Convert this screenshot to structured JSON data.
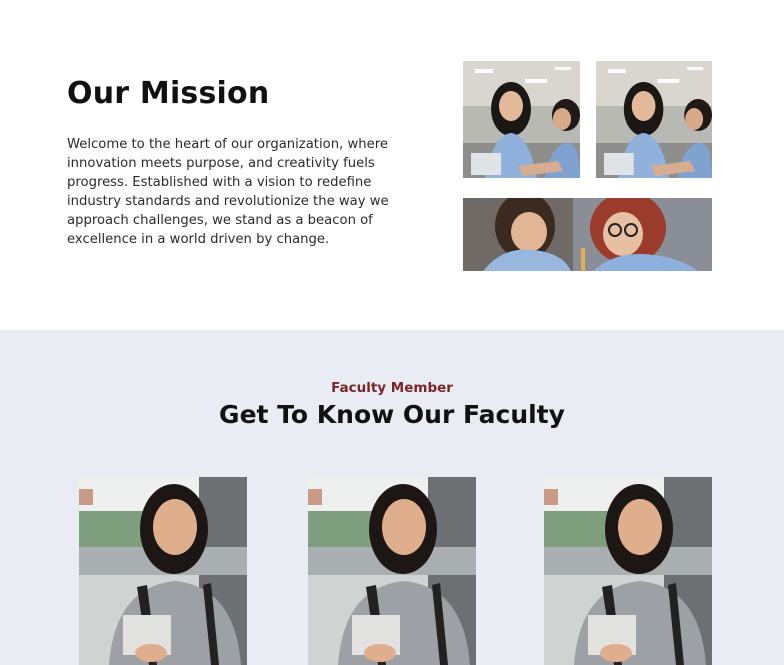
{
  "mission": {
    "title": "Our Mission",
    "text": "Welcome to the heart of our organization, where innovation meets purpose, and creativity fuels progress. Established with a vision to redefine industry standards and revolutionize the way we approach challenges, we stand as a beacon of excellence in a world driven by change.",
    "photos": [
      "students-laptop-photo",
      "students-laptop-photo",
      "students-laughing-photo"
    ]
  },
  "faculty": {
    "kicker": "Faculty Member",
    "title": "Get To Know Our Faculty",
    "members": [
      "faculty-photo",
      "faculty-photo",
      "faculty-photo"
    ]
  },
  "colors": {
    "faculty_bg": "#e9ecf3",
    "kicker": "#7b2626",
    "heading": "#111111"
  }
}
